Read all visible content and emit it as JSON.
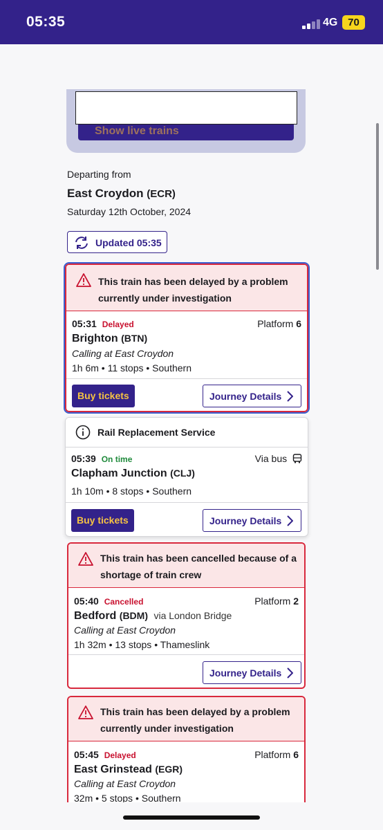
{
  "status_bar": {
    "time": "05:35",
    "network": "4G",
    "battery": "70"
  },
  "live_trains": {
    "button_label": "Show live trains"
  },
  "departure": {
    "label": "Departing from",
    "station": "East Croydon",
    "station_code": "(ECR)",
    "date": "Saturday 12th October, 2024",
    "updated_label": "Updated 05:35"
  },
  "trains": [
    {
      "alert": "This train has been delayed by a problem currently under investigation",
      "time": "05:31",
      "status": "Delayed",
      "platform_label": "Platform",
      "platform": "6",
      "destination": "Brighton",
      "code": "(BTN)",
      "calling": "Calling at East Croydon",
      "meta": "1h 6m • 11 stops • Southern",
      "buy_label": "Buy tickets",
      "details_label": "Journey Details"
    },
    {
      "alert": "Rail Replacement Service",
      "time": "05:39",
      "status": "On time",
      "via_label": "Via bus",
      "destination": "Clapham Junction",
      "code": "(CLJ)",
      "meta": "1h 10m • 8 stops • Southern",
      "buy_label": "Buy tickets",
      "details_label": "Journey Details"
    },
    {
      "alert": "This train has been cancelled because of a shortage of train crew",
      "time": "05:40",
      "status": "Cancelled",
      "platform_label": "Platform",
      "platform": "2",
      "destination": "Bedford",
      "code": "(BDM)",
      "via": "via London Bridge",
      "calling": "Calling at East Croydon",
      "meta": "1h 32m • 13 stops • Thameslink",
      "details_label": "Journey Details"
    },
    {
      "alert": "This train has been delayed by a problem currently under investigation",
      "time": "05:45",
      "status": "Delayed",
      "platform_label": "Platform",
      "platform": "6",
      "destination": "East Grinstead",
      "code": "(EGR)",
      "calling": "Calling at East Croydon",
      "meta": "32m • 5 stops • Southern"
    }
  ],
  "colors": {
    "brand": "#33228a",
    "accent": "#f6c343",
    "alert_red": "#c8102e",
    "on_time_green": "#1f8a3b"
  }
}
